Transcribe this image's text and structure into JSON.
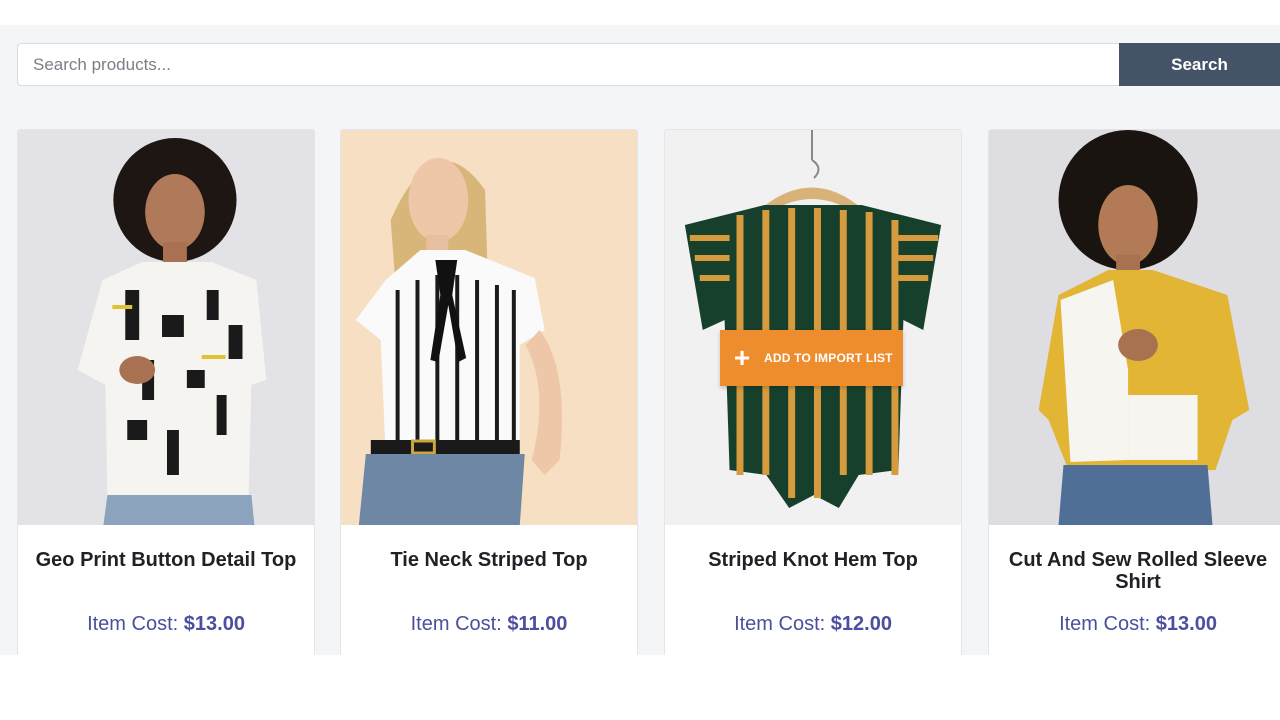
{
  "search": {
    "placeholder": "Search products...",
    "value": "",
    "button_label": "Search"
  },
  "products": [
    {
      "title": "Geo Print Button Detail Top",
      "cost_label": "Item Cost:",
      "price": "$13.00"
    },
    {
      "title": "Tie Neck Striped Top",
      "cost_label": "Item Cost:",
      "price": "$11.00"
    },
    {
      "title": "Striped Knot Hem Top",
      "cost_label": "Item Cost:",
      "price": "$12.00",
      "hover_action": "ADD TO IMPORT LIST"
    },
    {
      "title": "Cut And Sew Rolled Sleeve Shirt",
      "cost_label": "Item Cost:",
      "price": "$13.00"
    }
  ],
  "colors": {
    "accent": "#455368",
    "price": "#4b4f9e",
    "import_button": "#ee8d2e"
  }
}
